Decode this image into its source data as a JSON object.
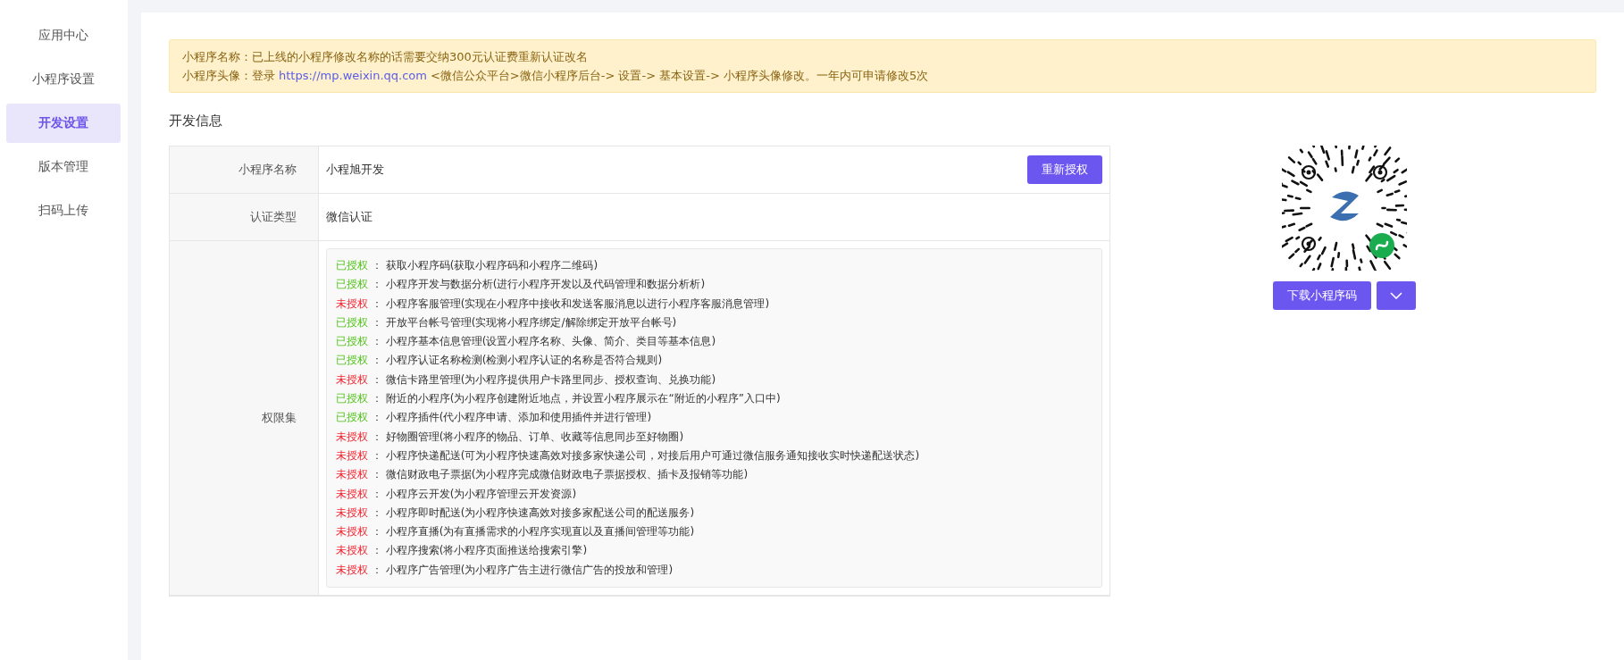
{
  "sidebar": {
    "items": [
      {
        "label": "应用中心",
        "selected": false
      },
      {
        "label": "小程序设置",
        "selected": false
      },
      {
        "label": "开发设置",
        "selected": true
      },
      {
        "label": "版本管理",
        "selected": false
      },
      {
        "label": "扫码上传",
        "selected": false
      }
    ]
  },
  "notice": {
    "lines": [
      {
        "label": "小程序名称：",
        "text": "已上线的小程序修改名称的话需要交纳300元认证费重新认证改名"
      },
      {
        "label": "小程序头像：",
        "before": "登录",
        "link": "https://mp.weixin.qq.com",
        "text": "<微信公众平台>微信小程序后台-> 设置-> 基本设置-> 小程序头像修改。一年内可申请修改5次"
      }
    ]
  },
  "section_title": "开发信息",
  "info_table": {
    "rows": [
      {
        "label": "小程序名称",
        "value": "小程旭开发",
        "button": "重新授权"
      },
      {
        "label": "认证类型",
        "value": "微信认证"
      }
    ],
    "permissions_label": "权限集",
    "permissions": [
      {
        "status": "已授权",
        "authorized": true,
        "text": "： 获取小程序码(获取小程序码和小程序二维码)"
      },
      {
        "status": "已授权",
        "authorized": true,
        "text": "： 小程序开发与数据分析(进行小程序开发以及代码管理和数据分析析)"
      },
      {
        "status": "未授权",
        "authorized": false,
        "text": "： 小程序客服管理(实现在小程序中接收和发送客服消息以进行小程序客服消息管理)"
      },
      {
        "status": "已授权",
        "authorized": true,
        "text": "： 开放平台帐号管理(实现将小程序绑定/解除绑定开放平台帐号)"
      },
      {
        "status": "已授权",
        "authorized": true,
        "text": "： 小程序基本信息管理(设置小程序名称、头像、简介、类目等基本信息)"
      },
      {
        "status": "已授权",
        "authorized": true,
        "text": "： 小程序认证名称检测(检测小程序认证的名称是否符合规则)"
      },
      {
        "status": "未授权",
        "authorized": false,
        "text": "： 微信卡路里管理(为小程序提供用户卡路里同步、授权查询、兑换功能)"
      },
      {
        "status": "已授权",
        "authorized": true,
        "text": "： 附近的小程序(为小程序创建附近地点，并设置小程序展示在“附近的小程序”入口中)"
      },
      {
        "status": "已授权",
        "authorized": true,
        "text": "： 小程序插件(代小程序申请、添加和使用插件并进行管理)"
      },
      {
        "status": "未授权",
        "authorized": false,
        "text": "： 好物圈管理(将小程序的物品、订单、收藏等信息同步至好物圈)"
      },
      {
        "status": "未授权",
        "authorized": false,
        "text": "： 小程序快递配送(可为小程序快速高效对接多家快递公司，对接后用户可通过微信服务通知接收实时快递配送状态)"
      },
      {
        "status": "未授权",
        "authorized": false,
        "text": "： 微信财政电子票据(为小程序完成微信财政电子票据授权、插卡及报销等功能)"
      },
      {
        "status": "未授权",
        "authorized": false,
        "text": "： 小程序云开发(为小程序管理云开发资源)"
      },
      {
        "status": "未授权",
        "authorized": false,
        "text": "： 小程序即时配送(为小程序快速高效对接多家配送公司的配送服务)"
      },
      {
        "status": "未授权",
        "authorized": false,
        "text": "： 小程序直播(为有直播需求的小程序实现直以及直播间管理等功能)"
      },
      {
        "status": "未授权",
        "authorized": false,
        "text": "： 小程序搜索(将小程序页面推送给搜索引擎)"
      },
      {
        "status": "未授权",
        "authorized": false,
        "text": "： 小程序广告管理(为小程序广告主进行微信广告的投放和管理)"
      }
    ]
  },
  "qr": {
    "download_button": "下载小程序码"
  }
}
